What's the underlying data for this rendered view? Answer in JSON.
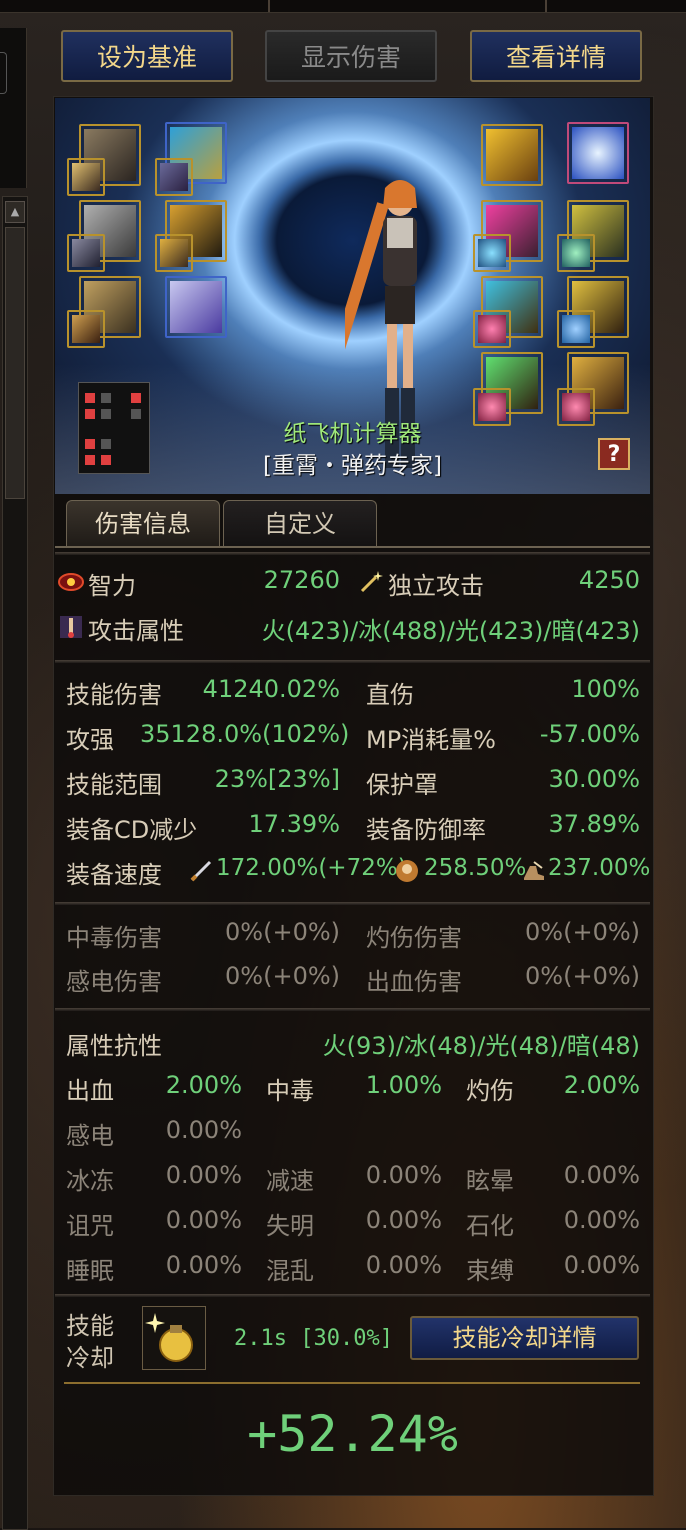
{
  "top_buttons": {
    "set_baseline": "设为基准",
    "show_damage": "显示伤害",
    "view_details": "查看详情"
  },
  "character": {
    "name": "纸飞机计算器",
    "class": "[重霄・弹药专家]"
  },
  "tabs": {
    "damage_info": "伤害信息",
    "custom": "自定义"
  },
  "primary": {
    "int_label": "智力",
    "int_value": "27260",
    "indep_label": "独立攻击",
    "indep_value": "4250",
    "elem_label": "攻击属性",
    "elem_value": "火(423)/冰(488)/光(423)/暗(423)"
  },
  "skill_stats": {
    "skill_dmg_label": "技能伤害",
    "skill_dmg_value": "41240.02%",
    "direct_label": "直伤",
    "direct_value": "100%",
    "atk_label": "攻强",
    "atk_value": "35128.0%(102%)",
    "mp_label": "MP消耗量%",
    "mp_value": "-57.00%",
    "range_label": "技能范围",
    "range_value": "23%[23%]",
    "shield_label": "保护罩",
    "shield_value": "30.00%",
    "cd_label": "装备CD减少",
    "cd_value": "17.39%",
    "def_label": "装备防御率",
    "def_value": "37.89%",
    "speed_label": "装备速度",
    "speed_atk": "172.00%(+72%)",
    "speed_cast": "258.50%",
    "speed_move": "237.00%"
  },
  "status_damage": {
    "poison_label": "中毒伤害",
    "poison_value": "0%(+0%)",
    "burn_label": "灼伤伤害",
    "burn_value": "0%(+0%)",
    "shock_label": "感电伤害",
    "shock_value": "0%(+0%)",
    "bleed_label": "出血伤害",
    "bleed_value": "0%(+0%)"
  },
  "resistance": {
    "elem_res_label": "属性抗性",
    "elem_res_value": "火(93)/冰(48)/光(48)/暗(48)",
    "bleed_label": "出血",
    "bleed_value": "2.00%",
    "poison_label": "中毒",
    "poison_value": "1.00%",
    "burn_label": "灼伤",
    "burn_value": "2.00%",
    "shock_label": "感电",
    "shock_value": "0.00%",
    "freeze_label": "冰冻",
    "freeze_value": "0.00%",
    "slow_label": "减速",
    "slow_value": "0.00%",
    "stun_label": "眩晕",
    "stun_value": "0.00%",
    "curse_label": "诅咒",
    "curse_value": "0.00%",
    "blind_label": "失明",
    "blind_value": "0.00%",
    "stone_label": "石化",
    "stone_value": "0.00%",
    "sleep_label": "睡眠",
    "sleep_value": "0.00%",
    "confuse_label": "混乱",
    "confuse_value": "0.00%",
    "bind_label": "束缚",
    "bind_value": "0.00%"
  },
  "cooldown": {
    "label_line1": "技能",
    "label_line2": "冷却",
    "value": "2.1s [30.0%]",
    "details_button": "技能冷却详情"
  },
  "result": "+52.24%",
  "colors": {
    "accent_green": "#6fd07a",
    "gold": "#f3d78a",
    "button_blue": "#20305e"
  }
}
